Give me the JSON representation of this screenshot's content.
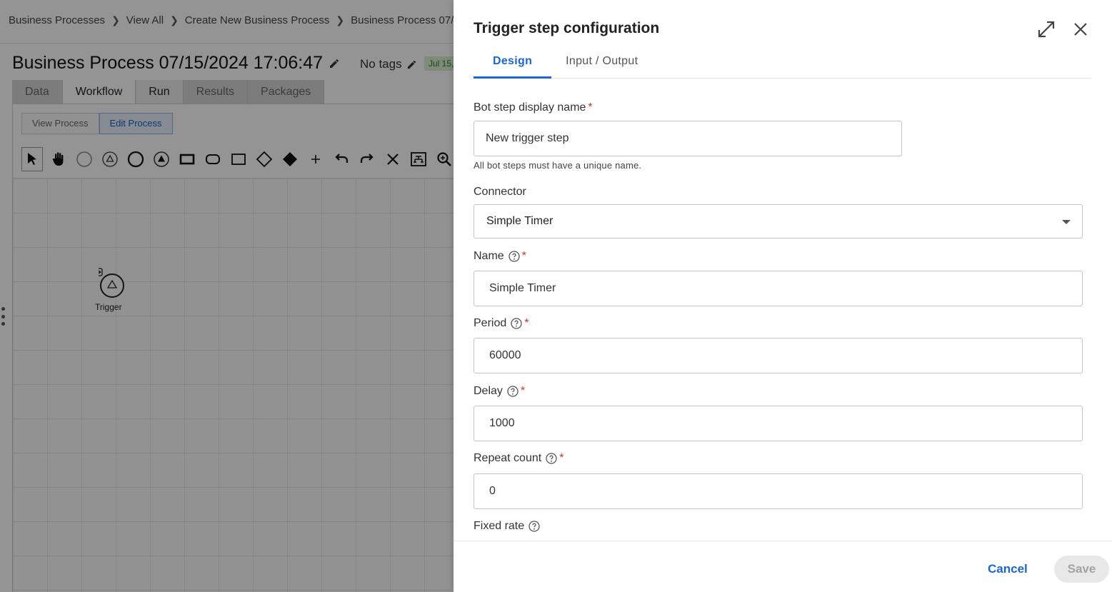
{
  "breadcrumb": [
    "Business Processes",
    "View All",
    "Create New Business Process",
    "Business Process 07/"
  ],
  "process": {
    "title": "Business Process 07/15/2024 17:06:47",
    "tags_label": "No tags",
    "date_chip": "Jul 15,"
  },
  "main_tabs": [
    "Data",
    "Workflow",
    "Run",
    "Results",
    "Packages"
  ],
  "modes": {
    "view": "View Process",
    "edit": "Edit Process"
  },
  "toolbar_icons": [
    "pointer-icon",
    "hand-icon",
    "circle-outline-icon",
    "triangle-circle-icon",
    "circle-thick-icon",
    "triangle-filled-circle-icon",
    "rectangle-thick-icon",
    "rounded-rect-icon",
    "rectangle-icon",
    "diamond-outline-icon",
    "diamond-filled-icon",
    "plus-icon",
    "undo-icon",
    "redo-icon",
    "delete-icon",
    "layout-icon",
    "zoom-icon"
  ],
  "canvas": {
    "trigger_label": "Trigger"
  },
  "drawer": {
    "title": "Trigger step configuration",
    "tabs": [
      "Design",
      "Input / Output"
    ],
    "fields": {
      "display_name": {
        "label": "Bot step display name",
        "value": "New trigger step",
        "hint": "All bot steps must have a unique name."
      },
      "connector": {
        "label": "Connector",
        "value": "Simple Timer"
      },
      "name": {
        "label": "Name",
        "value": "Simple Timer"
      },
      "period": {
        "label": "Period",
        "value": "60000"
      },
      "delay": {
        "label": "Delay",
        "value": "1000"
      },
      "repeat_count": {
        "label": "Repeat count",
        "value": "0"
      },
      "fixed_rate": {
        "label": "Fixed rate"
      }
    },
    "required_marker": "*",
    "footer": {
      "cancel": "Cancel",
      "save": "Save"
    }
  },
  "colors": {
    "accent": "#1a66d2",
    "required": "#d0342c",
    "overlay": "rgba(0,0,0,0.42)"
  }
}
